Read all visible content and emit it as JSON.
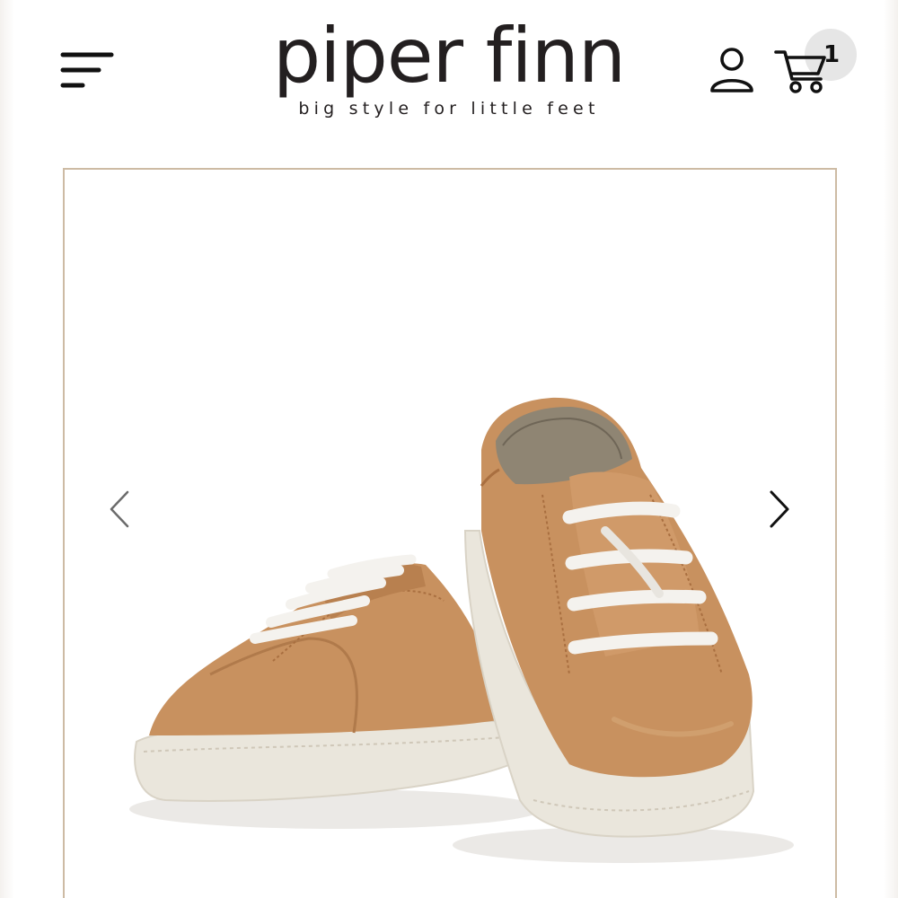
{
  "header": {
    "brand_name": "piper finn",
    "tagline": "big style for little feet",
    "menu_icon": "menu-icon",
    "account_icon": "user-icon",
    "cart_icon": "cart-icon",
    "cart_count": "1"
  },
  "gallery": {
    "prev_icon": "chevron-left-icon",
    "next_icon": "chevron-right-icon",
    "image_subject": "pair of tan leather kids sneakers with white laces and cream soles"
  },
  "colors": {
    "frame_border": "#cdbba4",
    "leather": "#c8915f",
    "sole": "#eae6dc",
    "laces": "#f4f2ee",
    "text": "#231f20",
    "badge": "#e6e6e6"
  }
}
